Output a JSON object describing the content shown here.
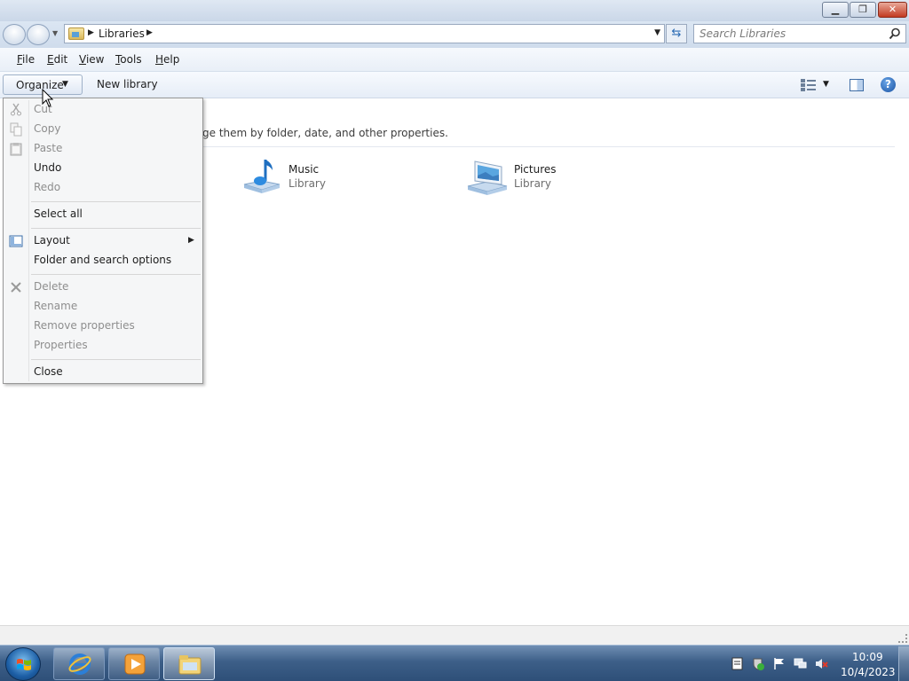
{
  "window": {
    "minimize_icon": "minimize-icon",
    "maximize_icon": "restore-icon",
    "close_icon": "close-icon"
  },
  "address": {
    "path": "Libraries",
    "search_placeholder": "Search Libraries"
  },
  "menubar": {
    "items": [
      "File",
      "Edit",
      "View",
      "Tools",
      "Help"
    ]
  },
  "toolbar": {
    "organize_label": "Organize",
    "new_library_label": "New library"
  },
  "content": {
    "description": "ge them by folder, date, and other properties.",
    "libraries": [
      {
        "name": "Music",
        "type": "Library",
        "icon": "music-library-icon"
      },
      {
        "name": "Pictures",
        "type": "Library",
        "icon": "pictures-library-icon"
      }
    ]
  },
  "organize_menu": {
    "items": [
      {
        "label": "Cut",
        "enabled": false,
        "icon": "scissors-icon"
      },
      {
        "label": "Copy",
        "enabled": false,
        "icon": "copy-icon"
      },
      {
        "label": "Paste",
        "enabled": false,
        "icon": "paste-icon"
      },
      {
        "label": "Undo",
        "enabled": true
      },
      {
        "label": "Redo",
        "enabled": false
      },
      {
        "label": "Select all",
        "enabled": true
      },
      {
        "label": "Layout",
        "enabled": true,
        "icon": "layout-icon",
        "submenu": true
      },
      {
        "label": "Folder and search options",
        "enabled": true
      },
      {
        "label": "Delete",
        "enabled": false,
        "icon": "delete-icon"
      },
      {
        "label": "Rename",
        "enabled": false
      },
      {
        "label": "Remove properties",
        "enabled": false
      },
      {
        "label": "Properties",
        "enabled": false
      },
      {
        "label": "Close",
        "enabled": true
      }
    ]
  },
  "taskbar": {
    "time": "10:09",
    "date": "10/4/2023",
    "pinned": [
      "internet-explorer-icon",
      "media-player-icon",
      "windows-explorer-icon"
    ]
  },
  "colors": {
    "titlebar": "#cad7e8",
    "taskbar": "#3d5f88",
    "menu_disabled_text": "#8e8e8e"
  }
}
